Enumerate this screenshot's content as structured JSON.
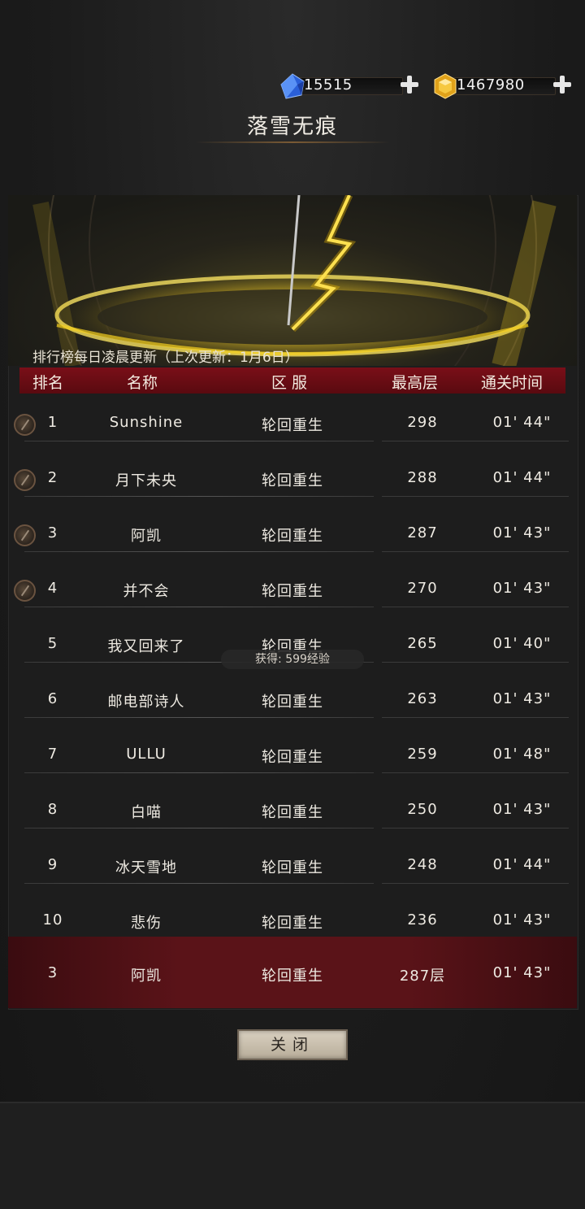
{
  "currency": {
    "diamonds": {
      "icon": "blue-gem-icon",
      "value": "15515",
      "color": "#2f6ee8"
    },
    "gold": {
      "icon": "gold-gem-icon",
      "value": "1467980",
      "color": "#e8a820"
    }
  },
  "title": "落雪无痕",
  "update_note": "排行榜每日凌晨更新（上次更新：1月6日）",
  "table": {
    "headers": {
      "rank": "排名",
      "name": "名称",
      "server": "区 服",
      "floor": "最高层",
      "time": "通关时间"
    },
    "rows": [
      {
        "rank": "1",
        "name": "Sunshine",
        "server": "轮回重生",
        "floor": "298",
        "time": "01' 44\""
      },
      {
        "rank": "2",
        "name": "月下未央",
        "server": "轮回重生",
        "floor": "288",
        "time": "01' 44\""
      },
      {
        "rank": "3",
        "name": "阿凯",
        "server": "轮回重生",
        "floor": "287",
        "time": "01' 43\""
      },
      {
        "rank": "4",
        "name": "并不会",
        "server": "轮回重生",
        "floor": "270",
        "time": "01' 43\""
      },
      {
        "rank": "5",
        "name": "我又回来了",
        "server": "轮回重生",
        "floor": "265",
        "time": "01' 40\""
      },
      {
        "rank": "6",
        "name": "邮电部诗人",
        "server": "轮回重生",
        "floor": "263",
        "time": "01' 43\""
      },
      {
        "rank": "7",
        "name": "ULLU",
        "server": "轮回重生",
        "floor": "259",
        "time": "01' 48\""
      },
      {
        "rank": "8",
        "name": "白喵",
        "server": "轮回重生",
        "floor": "250",
        "time": "01' 43\""
      },
      {
        "rank": "9",
        "name": "冰天雪地",
        "server": "轮回重生",
        "floor": "248",
        "time": "01' 44\""
      },
      {
        "rank": "10",
        "name": "悲伤",
        "server": "轮回重生",
        "floor": "236",
        "time": "01' 43\""
      }
    ]
  },
  "toast": "获得: 599经验",
  "self_row": {
    "rank": "3",
    "name": "阿凯",
    "server": "轮回重生",
    "floor": "287层",
    "time": "01' 43\""
  },
  "close_label": "关闭",
  "colors": {
    "header_red": "#7a0f18",
    "self_row_red": "#5a1318",
    "glow_yellow": "#f5d020"
  }
}
